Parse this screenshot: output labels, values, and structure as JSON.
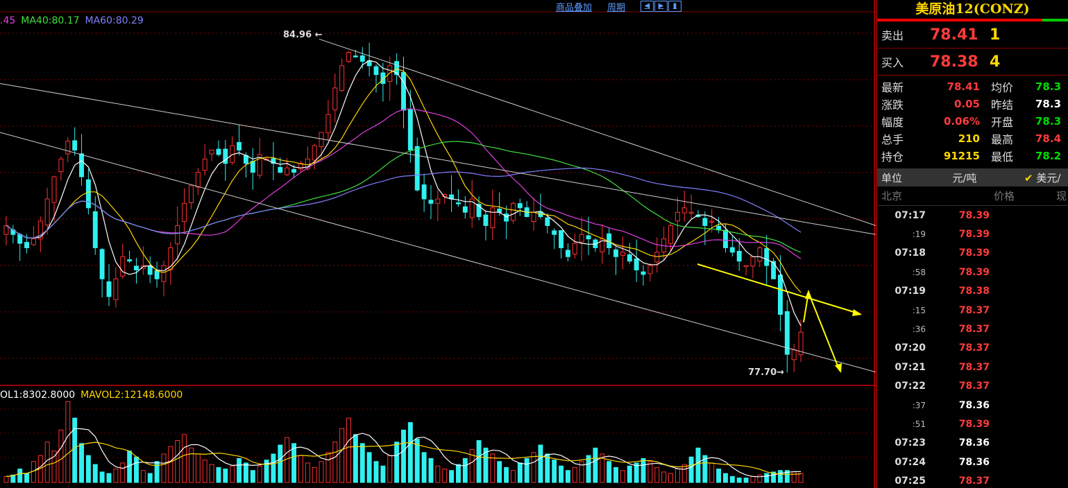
{
  "toolbar": {
    "overlay": "商品叠加",
    "period": "周期"
  },
  "ma_legend": [
    {
      "text": ".45",
      "color": "#e040e0"
    },
    {
      "text": "MA40:80.17",
      "color": "#40e040"
    },
    {
      "text": "MA60:80.29",
      "color": "#8080ff"
    }
  ],
  "vol_legend": [
    {
      "text": "OL1:8302.8000",
      "color": "#ffffff"
    },
    {
      "text": "MAVOL2:12148.6000",
      "color": "#ffd700"
    }
  ],
  "chart_data": {
    "type": "candlestick",
    "annotations": {
      "high_label": "84.96",
      "low_label": "77.70"
    },
    "price_range": [
      77.2,
      85.6
    ],
    "channel_lines": [
      {
        "from": [
          0,
          84.0
        ],
        "to": [
          1262,
          80.6
        ]
      },
      {
        "from": [
          0,
          82.9
        ],
        "to": [
          1262,
          77.5
        ]
      },
      {
        "from": [
          460,
          85.0
        ],
        "to": [
          1262,
          80.8
        ]
      }
    ],
    "closes": [
      80.8,
      80.6,
      80.4,
      80.3,
      80.5,
      80.9,
      81.4,
      81.9,
      82.3,
      82.7,
      82.5,
      81.9,
      81.2,
      80.3,
      79.6,
      79.2,
      79.6,
      80.1,
      80.0,
      79.8,
      79.9,
      79.7,
      79.6,
      79.9,
      80.3,
      80.8,
      81.3,
      81.7,
      82.0,
      82.3,
      82.5,
      82.4,
      82.2,
      82.6,
      82.5,
      82.2,
      82.0,
      82.4,
      82.3,
      82.2,
      82.0,
      82.1,
      82.0,
      82.2,
      82.3,
      82.6,
      82.9,
      83.3,
      83.9,
      84.4,
      84.7,
      84.6,
      84.5,
      84.4,
      84.2,
      84.0,
      84.4,
      84.2,
      83.4,
      82.5,
      81.6,
      81.4,
      81.3,
      81.4,
      81.5,
      81.4,
      81.3,
      81.1,
      81.4,
      81.0,
      80.8,
      81.2,
      81.1,
      80.9,
      81.3,
      81.2,
      81.0,
      81.1,
      81.0,
      80.8,
      80.6,
      80.3,
      80.1,
      80.4,
      80.6,
      80.5,
      80.3,
      80.5,
      80.3,
      80.1,
      80.2,
      80.0,
      79.8,
      79.7,
      79.9,
      80.2,
      80.5,
      80.8,
      81.1,
      81.2,
      81.1,
      81.0,
      80.8,
      80.9,
      80.7,
      80.3,
      80.2,
      80.0,
      79.9,
      80.1,
      80.3,
      79.9,
      79.6,
      78.8,
      77.9,
      78.0,
      78.4
    ],
    "volumes": [
      0.4,
      0.5,
      0.9,
      0.6,
      1.4,
      1.8,
      2.7,
      2.1,
      3.5,
      5.4,
      4.3,
      2.6,
      1.8,
      1.2,
      0.7,
      0.6,
      0.9,
      1.3,
      2.1,
      1.7,
      0.8,
      0.6,
      1.4,
      1.9,
      2.4,
      2.8,
      3.2,
      2.3,
      1.9,
      1.5,
      1.2,
      1.0,
      0.9,
      1.1,
      1.6,
      1.3,
      0.8,
      1.1,
      1.5,
      1.9,
      2.5,
      3.0,
      2.6,
      1.8,
      1.3,
      1.0,
      1.4,
      2.0,
      2.7,
      3.6,
      4.3,
      3.2,
      2.6,
      2.0,
      1.4,
      1.1,
      1.8,
      2.7,
      3.5,
      4.0,
      2.9,
      2.0,
      1.6,
      1.1,
      0.9,
      0.8,
      1.2,
      1.6,
      2.2,
      2.8,
      2.3,
      1.9,
      1.4,
      1.0,
      0.8,
      1.3,
      1.6,
      2.0,
      2.5,
      1.9,
      1.5,
      1.1,
      0.8,
      1.0,
      1.4,
      1.8,
      2.3,
      1.9,
      1.4,
      1.0,
      0.8,
      1.1,
      1.3,
      1.6,
      1.4,
      1.0,
      0.7,
      0.6,
      0.9,
      1.2,
      1.7,
      2.3,
      1.8,
      1.3,
      0.9,
      0.6,
      0.4,
      0.3,
      0.3,
      0.4,
      0.5,
      0.6,
      0.7,
      0.8,
      0.8,
      0.7,
      0.6
    ]
  },
  "quote": {
    "title": "美原油12(CONZ)",
    "sell_label": "卖出",
    "sell_price": "78.41",
    "sell_vol": "1",
    "buy_label": "买入",
    "buy_price": "78.38",
    "buy_vol": "4",
    "stats": [
      {
        "l1": "最新",
        "v1": "78.41",
        "c1": "#ff3b3b",
        "l2": "均价",
        "v2": "78.3",
        "c2": "#00dd00"
      },
      {
        "l1": "涨跌",
        "v1": "0.05",
        "c1": "#ff3b3b",
        "l2": "昨结",
        "v2": "78.3",
        "c2": "#ffffff"
      },
      {
        "l1": "幅度",
        "v1": "0.06%",
        "c1": "#ff3b3b",
        "l2": "开盘",
        "v2": "78.3",
        "c2": "#00dd00"
      },
      {
        "l1": "总手",
        "v1": "210",
        "c1": "#ffd700",
        "l2": "最高",
        "v2": "78.4",
        "c2": "#ff3b3b"
      },
      {
        "l1": "持仓",
        "v1": "91215",
        "c1": "#ffd700",
        "l2": "最低",
        "v2": "78.2",
        "c2": "#00dd00"
      }
    ],
    "unit_label": "单位",
    "unit_value": "元/吨",
    "unit_alt": "美元/",
    "tick_head": {
      "time": "北京",
      "price": "价格",
      "vol": "现"
    },
    "ticks": [
      {
        "t": "07:17",
        "small": false,
        "p": "78.39",
        "c": "#ff3b3b"
      },
      {
        "t": ":19",
        "small": true,
        "p": "78.39",
        "c": "#ff3b3b"
      },
      {
        "t": "07:18",
        "small": false,
        "p": "78.39",
        "c": "#ff3b3b"
      },
      {
        "t": ":58",
        "small": true,
        "p": "78.39",
        "c": "#ff3b3b"
      },
      {
        "t": "07:19",
        "small": false,
        "p": "78.38",
        "c": "#ff3b3b"
      },
      {
        "t": ":15",
        "small": true,
        "p": "78.37",
        "c": "#ff3b3b"
      },
      {
        "t": ":36",
        "small": true,
        "p": "78.37",
        "c": "#ff3b3b"
      },
      {
        "t": "07:20",
        "small": false,
        "p": "78.37",
        "c": "#ff3b3b"
      },
      {
        "t": "07:21",
        "small": false,
        "p": "78.37",
        "c": "#ff3b3b"
      },
      {
        "t": "07:22",
        "small": false,
        "p": "78.37",
        "c": "#ff3b3b"
      },
      {
        "t": ":37",
        "small": true,
        "p": "78.36",
        "c": "#ffffff"
      },
      {
        "t": ":51",
        "small": true,
        "p": "78.39",
        "c": "#ff3b3b"
      },
      {
        "t": "07:23",
        "small": false,
        "p": "78.36",
        "c": "#ffffff"
      },
      {
        "t": "07:24",
        "small": false,
        "p": "78.36",
        "c": "#ffffff"
      },
      {
        "t": "07:25",
        "small": false,
        "p": "78.37",
        "c": "#ff3b3b"
      }
    ]
  }
}
